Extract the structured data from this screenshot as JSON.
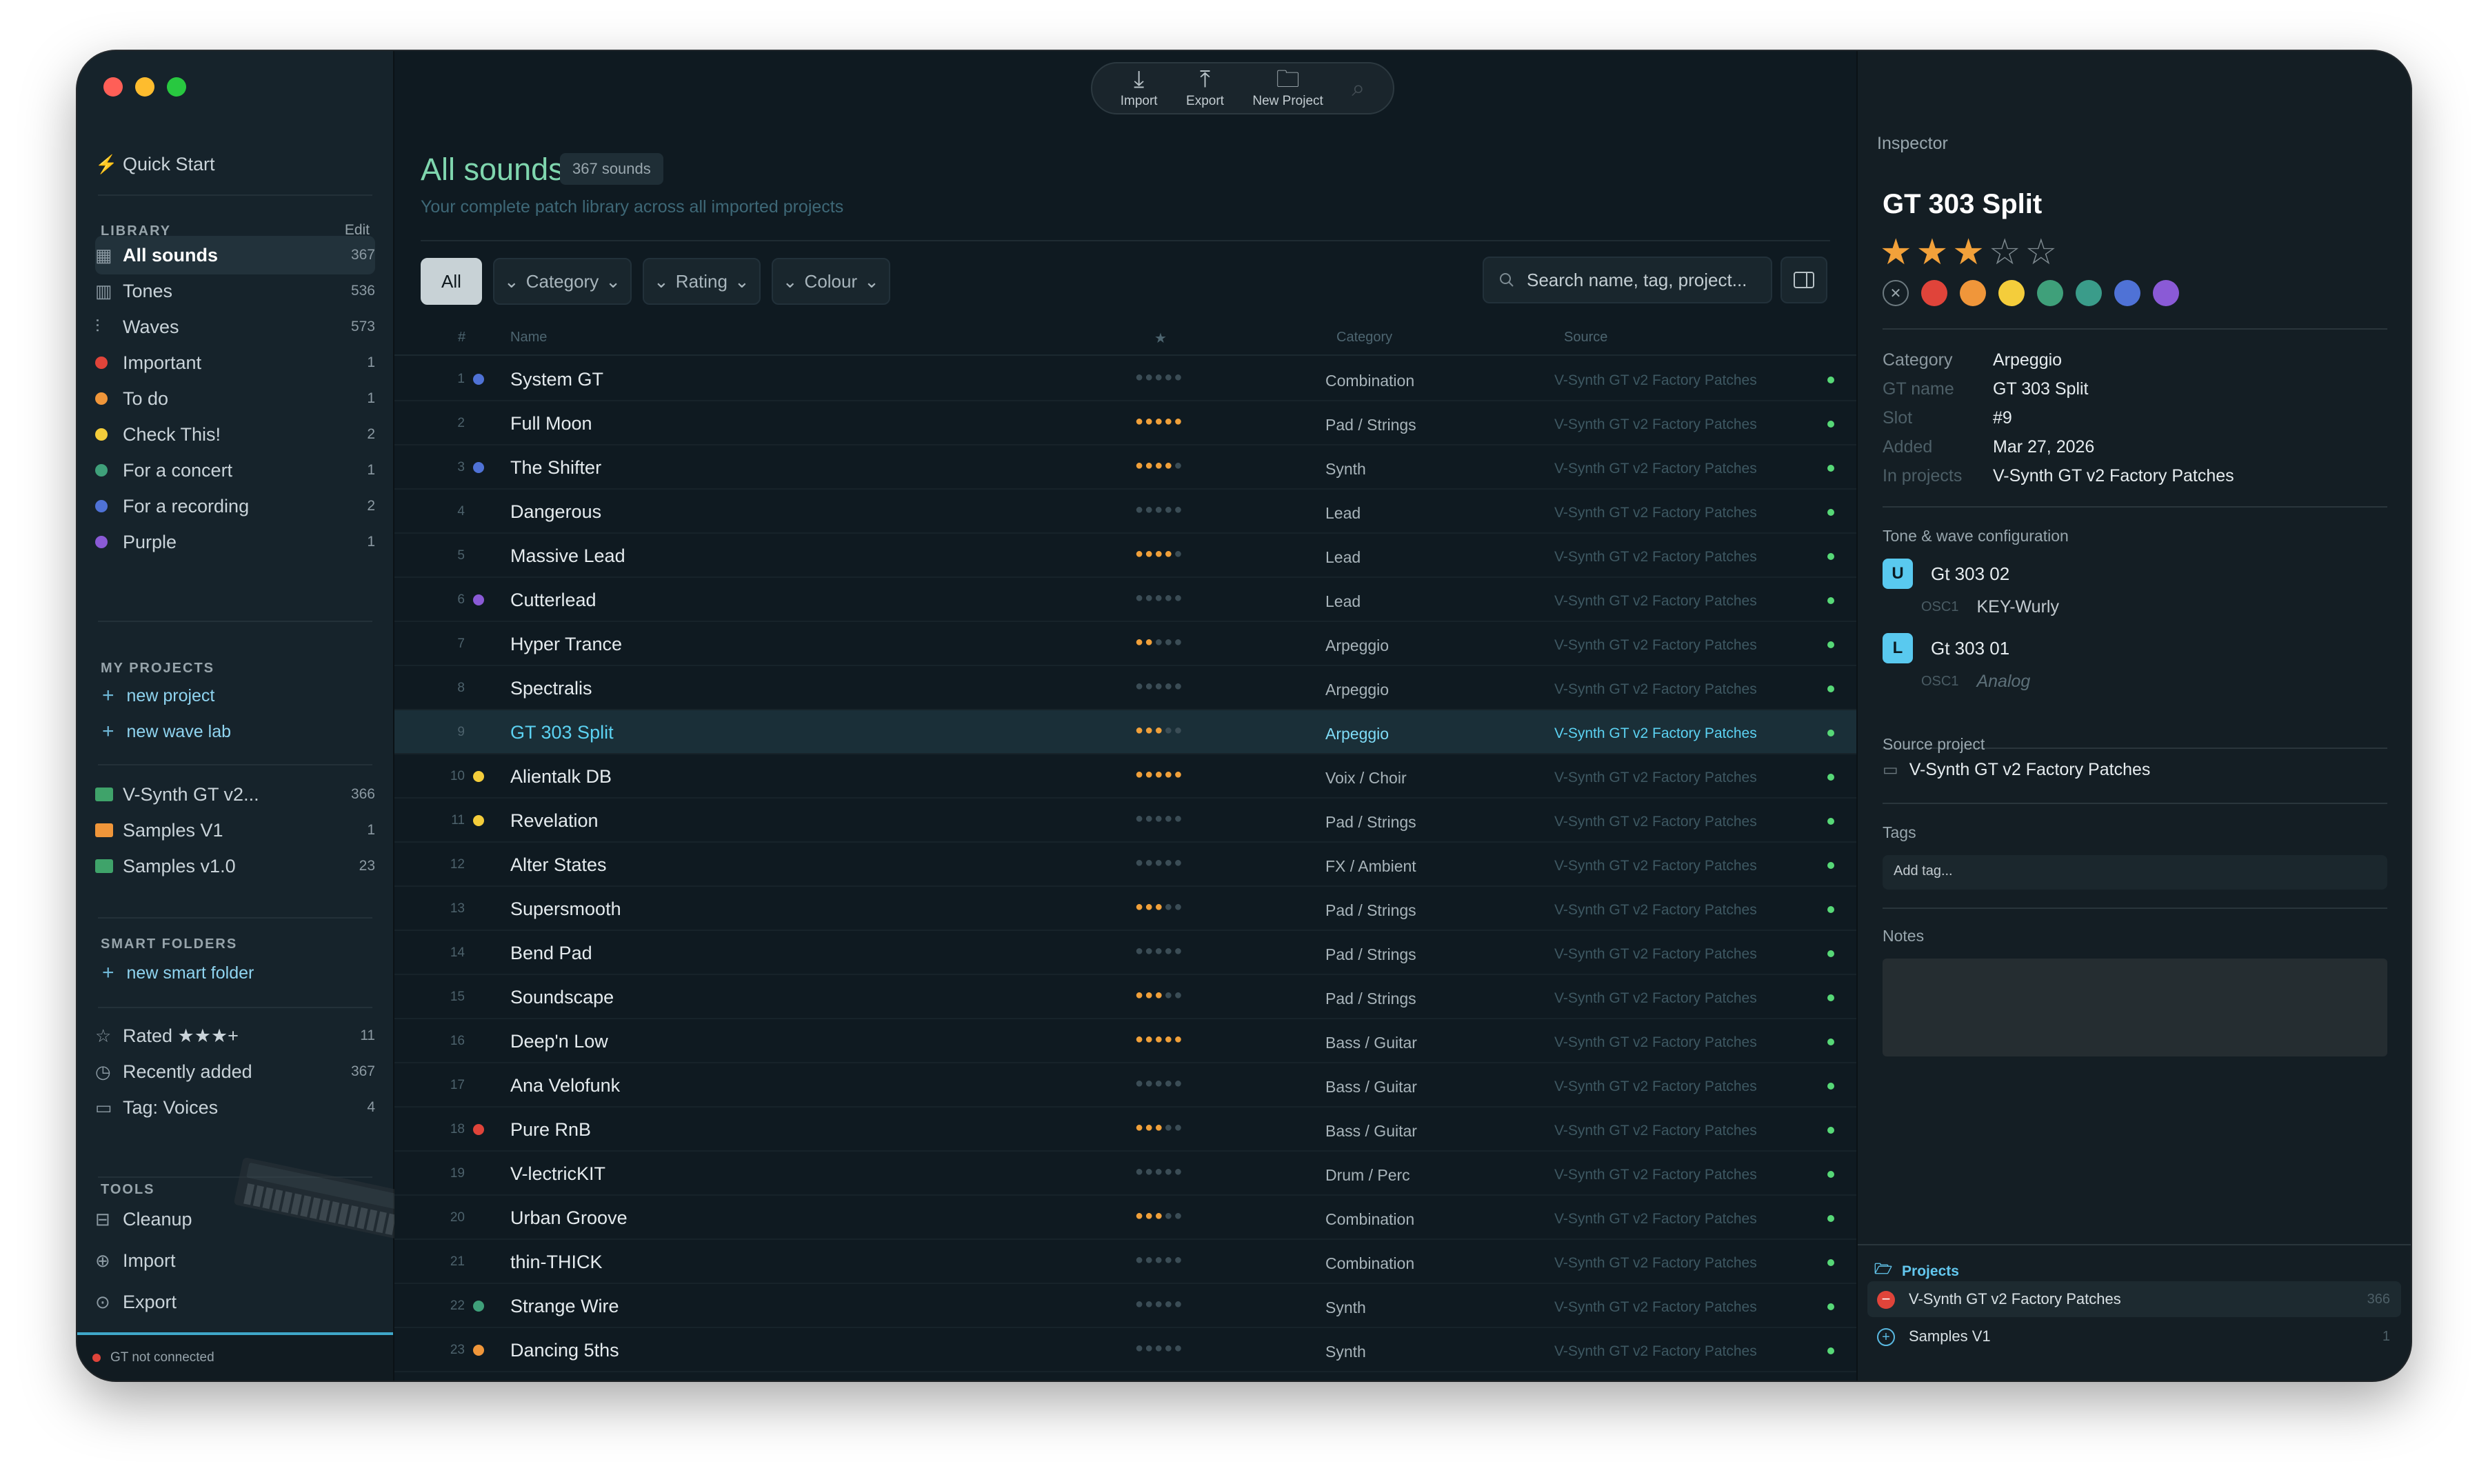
{
  "sidebar": {
    "quick_start": "Quick Start",
    "library_header": "LIBRARY",
    "edit": "Edit",
    "library": [
      {
        "label": "All sounds",
        "count": "367",
        "icon": "grid-icon"
      },
      {
        "label": "Tones",
        "count": "536",
        "icon": "keys-icon"
      },
      {
        "label": "Waves",
        "count": "573",
        "icon": "waveform-icon"
      },
      {
        "label": "Important",
        "count": "1",
        "color": "#e0443a"
      },
      {
        "label": "To do",
        "count": "1",
        "color": "#f0963a"
      },
      {
        "label": "Check This!",
        "count": "2",
        "color": "#f4cd3b"
      },
      {
        "label": "For a concert",
        "count": "1",
        "color": "#3fa07a"
      },
      {
        "label": "For a recording",
        "count": "2",
        "color": "#4f72d6"
      },
      {
        "label": "Purple",
        "count": "1",
        "color": "#8a5ad6"
      }
    ],
    "projects_header": "MY PROJECTS",
    "new_project": "new project",
    "new_wave_lab": "new wave lab",
    "projects": [
      {
        "label": "V-Synth GT v2...",
        "count": "366",
        "color": "#3fa36a"
      },
      {
        "label": "Samples V1",
        "count": "1",
        "color": "#f0963a"
      },
      {
        "label": "Samples v1.0",
        "count": "23",
        "color": "#3fa36a"
      }
    ],
    "smart_header": "SMART FOLDERS",
    "new_smart_folder": "new smart folder",
    "smart": [
      {
        "label": "Rated ★★★+",
        "count": "11"
      },
      {
        "label": "Recently added",
        "count": "367"
      },
      {
        "label": "Tag: Voices",
        "count": "4"
      }
    ],
    "tools_header": "TOOLS",
    "tools": [
      {
        "label": "Cleanup"
      },
      {
        "label": "Import"
      },
      {
        "label": "Export"
      }
    ],
    "status": "GT not connected"
  },
  "toolbar": {
    "import": "Import",
    "export": "Export",
    "new_project": "New Project"
  },
  "main": {
    "title": "All sounds",
    "count_badge": "367 sounds",
    "subtitle": "Your complete patch library across all imported projects",
    "filters": {
      "all": "All",
      "category": "Category",
      "rating": "Rating",
      "colour": "Colour"
    },
    "search_placeholder": "Search name, tag, project...",
    "columns": {
      "num": "#",
      "name": "Name",
      "star": "★",
      "category": "Category",
      "source": "Source"
    },
    "rows": [
      {
        "n": "1",
        "name": "System GT",
        "rating": 0,
        "category": "Combination",
        "source": "V-Synth GT v2 Factory Patches",
        "color": "#4f72d6"
      },
      {
        "n": "2",
        "name": "Full Moon",
        "rating": 5,
        "category": "Pad / Strings",
        "source": "V-Synth GT v2 Factory Patches",
        "color": ""
      },
      {
        "n": "3",
        "name": "The Shifter",
        "rating": 4,
        "category": "Synth",
        "source": "V-Synth GT v2 Factory Patches",
        "color": "#4f72d6"
      },
      {
        "n": "4",
        "name": "Dangerous",
        "rating": 0,
        "category": "Lead",
        "source": "V-Synth GT v2 Factory Patches",
        "color": ""
      },
      {
        "n": "5",
        "name": "Massive Lead",
        "rating": 4,
        "category": "Lead",
        "source": "V-Synth GT v2 Factory Patches",
        "color": ""
      },
      {
        "n": "6",
        "name": "Cutterlead",
        "rating": 0,
        "category": "Lead",
        "source": "V-Synth GT v2 Factory Patches",
        "color": "#8a5ad6"
      },
      {
        "n": "7",
        "name": "Hyper Trance",
        "rating": 2,
        "category": "Arpeggio",
        "source": "V-Synth GT v2 Factory Patches",
        "color": ""
      },
      {
        "n": "8",
        "name": "Spectralis",
        "rating": 0,
        "category": "Arpeggio",
        "source": "V-Synth GT v2 Factory Patches",
        "color": ""
      },
      {
        "n": "9",
        "name": "GT 303 Split",
        "rating": 3,
        "category": "Arpeggio",
        "source": "V-Synth GT v2 Factory Patches",
        "color": "",
        "selected": true
      },
      {
        "n": "10",
        "name": "Alientalk DB",
        "rating": 5,
        "category": "Voix / Choir",
        "source": "V-Synth GT v2 Factory Patches",
        "color": "#f4cd3b"
      },
      {
        "n": "11",
        "name": "Revelation",
        "rating": 0,
        "category": "Pad / Strings",
        "source": "V-Synth GT v2 Factory Patches",
        "color": "#f4cd3b"
      },
      {
        "n": "12",
        "name": "Alter States",
        "rating": 0,
        "category": "FX / Ambient",
        "source": "V-Synth GT v2 Factory Patches",
        "color": ""
      },
      {
        "n": "13",
        "name": "Supersmooth",
        "rating": 3,
        "category": "Pad / Strings",
        "source": "V-Synth GT v2 Factory Patches",
        "color": ""
      },
      {
        "n": "14",
        "name": "Bend Pad",
        "rating": 0,
        "category": "Pad / Strings",
        "source": "V-Synth GT v2 Factory Patches",
        "color": ""
      },
      {
        "n": "15",
        "name": "Soundscape",
        "rating": 3,
        "category": "Pad / Strings",
        "source": "V-Synth GT v2 Factory Patches",
        "color": ""
      },
      {
        "n": "16",
        "name": "Deep'n Low",
        "rating": 5,
        "category": "Bass / Guitar",
        "source": "V-Synth GT v2 Factory Patches",
        "color": ""
      },
      {
        "n": "17",
        "name": "Ana Velofunk",
        "rating": 0,
        "category": "Bass / Guitar",
        "source": "V-Synth GT v2 Factory Patches",
        "color": ""
      },
      {
        "n": "18",
        "name": "Pure RnB",
        "rating": 3,
        "category": "Bass / Guitar",
        "source": "V-Synth GT v2 Factory Patches",
        "color": "#e0443a"
      },
      {
        "n": "19",
        "name": "V-lectricKIT",
        "rating": 0,
        "category": "Drum / Perc",
        "source": "V-Synth GT v2 Factory Patches",
        "color": ""
      },
      {
        "n": "20",
        "name": "Urban Groove",
        "rating": 3,
        "category": "Combination",
        "source": "V-Synth GT v2 Factory Patches",
        "color": ""
      },
      {
        "n": "21",
        "name": "thin-THICK",
        "rating": 0,
        "category": "Combination",
        "source": "V-Synth GT v2 Factory Patches",
        "color": ""
      },
      {
        "n": "22",
        "name": "Strange Wire",
        "rating": 0,
        "category": "Synth",
        "source": "V-Synth GT v2 Factory Patches",
        "color": "#3fa07a"
      },
      {
        "n": "23",
        "name": "Dancing 5ths",
        "rating": 0,
        "category": "Synth",
        "source": "V-Synth GT v2 Factory Patches",
        "color": "#f0963a"
      }
    ]
  },
  "inspector": {
    "header": "Inspector",
    "title": "GT 303 Split",
    "rating": 3,
    "colors": [
      "#e0443a",
      "#f0963a",
      "#f4cd3b",
      "#3fa07a",
      "#3a9c8a",
      "#4f72d6",
      "#8a5ad6"
    ],
    "fields": [
      {
        "k": "Category",
        "v": "Arpeggio"
      },
      {
        "k": "GT name",
        "v": "GT 303 Split"
      },
      {
        "k": "Slot",
        "v": "#9"
      },
      {
        "k": "Added",
        "v": "Mar 27, 2026"
      },
      {
        "k": "In projects",
        "v": "V-Synth GT v2 Factory Patches"
      }
    ],
    "tone_header": "Tone & wave configuration",
    "tones": [
      {
        "badge": "U",
        "name": "Gt 303 02",
        "osc": "OSC1",
        "wave": "KEY-Wurly"
      },
      {
        "badge": "L",
        "name": "Gt 303 01",
        "osc": "OSC1",
        "wave": "Analog"
      }
    ],
    "source_header": "Source project",
    "source": "V-Synth GT v2 Factory Patches",
    "tags_header": "Tags",
    "tag_placeholder": "Add tag...",
    "notes_header": "Notes",
    "projects_header": "Projects",
    "projects": [
      {
        "label": "V-Synth GT v2 Factory Patches",
        "count": "366"
      },
      {
        "label": "Samples V1",
        "count": "1"
      }
    ]
  }
}
